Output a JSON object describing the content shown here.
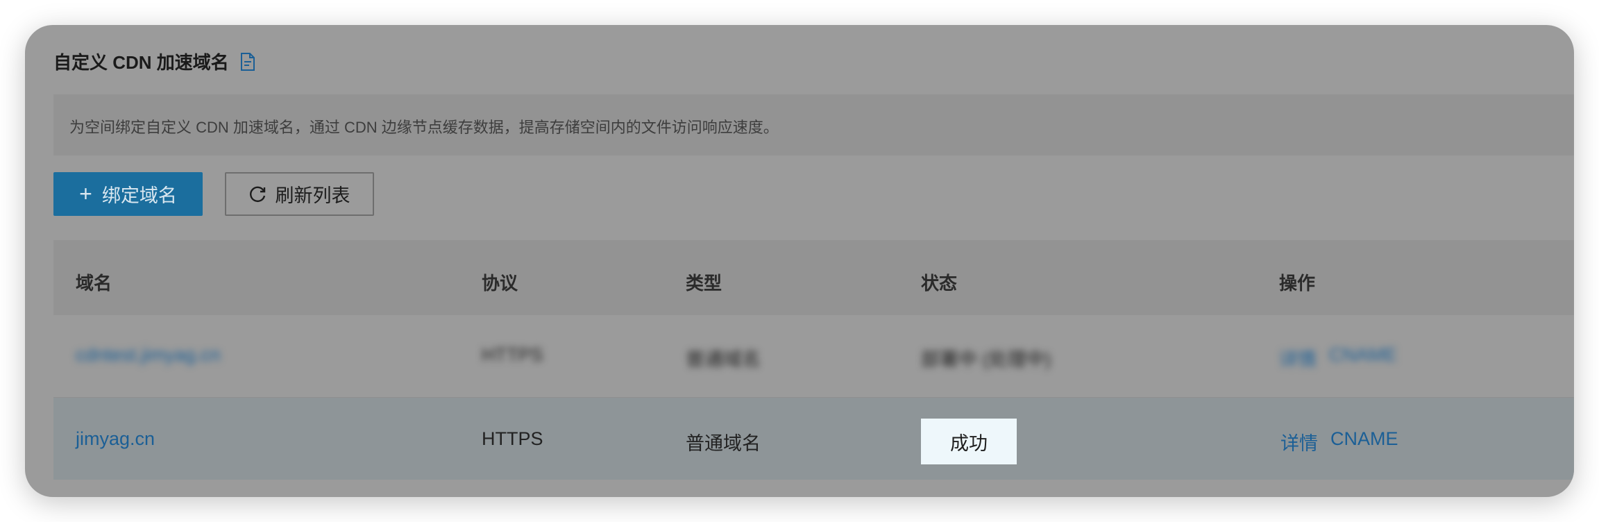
{
  "header": {
    "title": "自定义 CDN 加速域名"
  },
  "info": {
    "text": "为空间绑定自定义 CDN 加速域名，通过 CDN 边缘节点缓存数据，提高存储空间内的文件访问响应速度。"
  },
  "toolbar": {
    "bind_label": "绑定域名",
    "refresh_label": "刷新列表"
  },
  "table": {
    "columns": [
      "域名",
      "协议",
      "类型",
      "状态",
      "操作"
    ],
    "rows": [
      {
        "domain": "cdntest.jimyag.cn",
        "protocol": "HTTPS",
        "type": "普通域名",
        "status": "部署中 (处理中)",
        "actions": [
          "详情",
          "CNAME"
        ]
      },
      {
        "domain": "jimyag.cn",
        "protocol": "HTTPS",
        "type": "普通域名",
        "status": "成功",
        "actions": [
          "详情",
          "CNAME"
        ]
      }
    ]
  },
  "colors": {
    "accent": "#1b6e9e",
    "link": "#1b5f96",
    "status_bg": "#eef7fb"
  }
}
